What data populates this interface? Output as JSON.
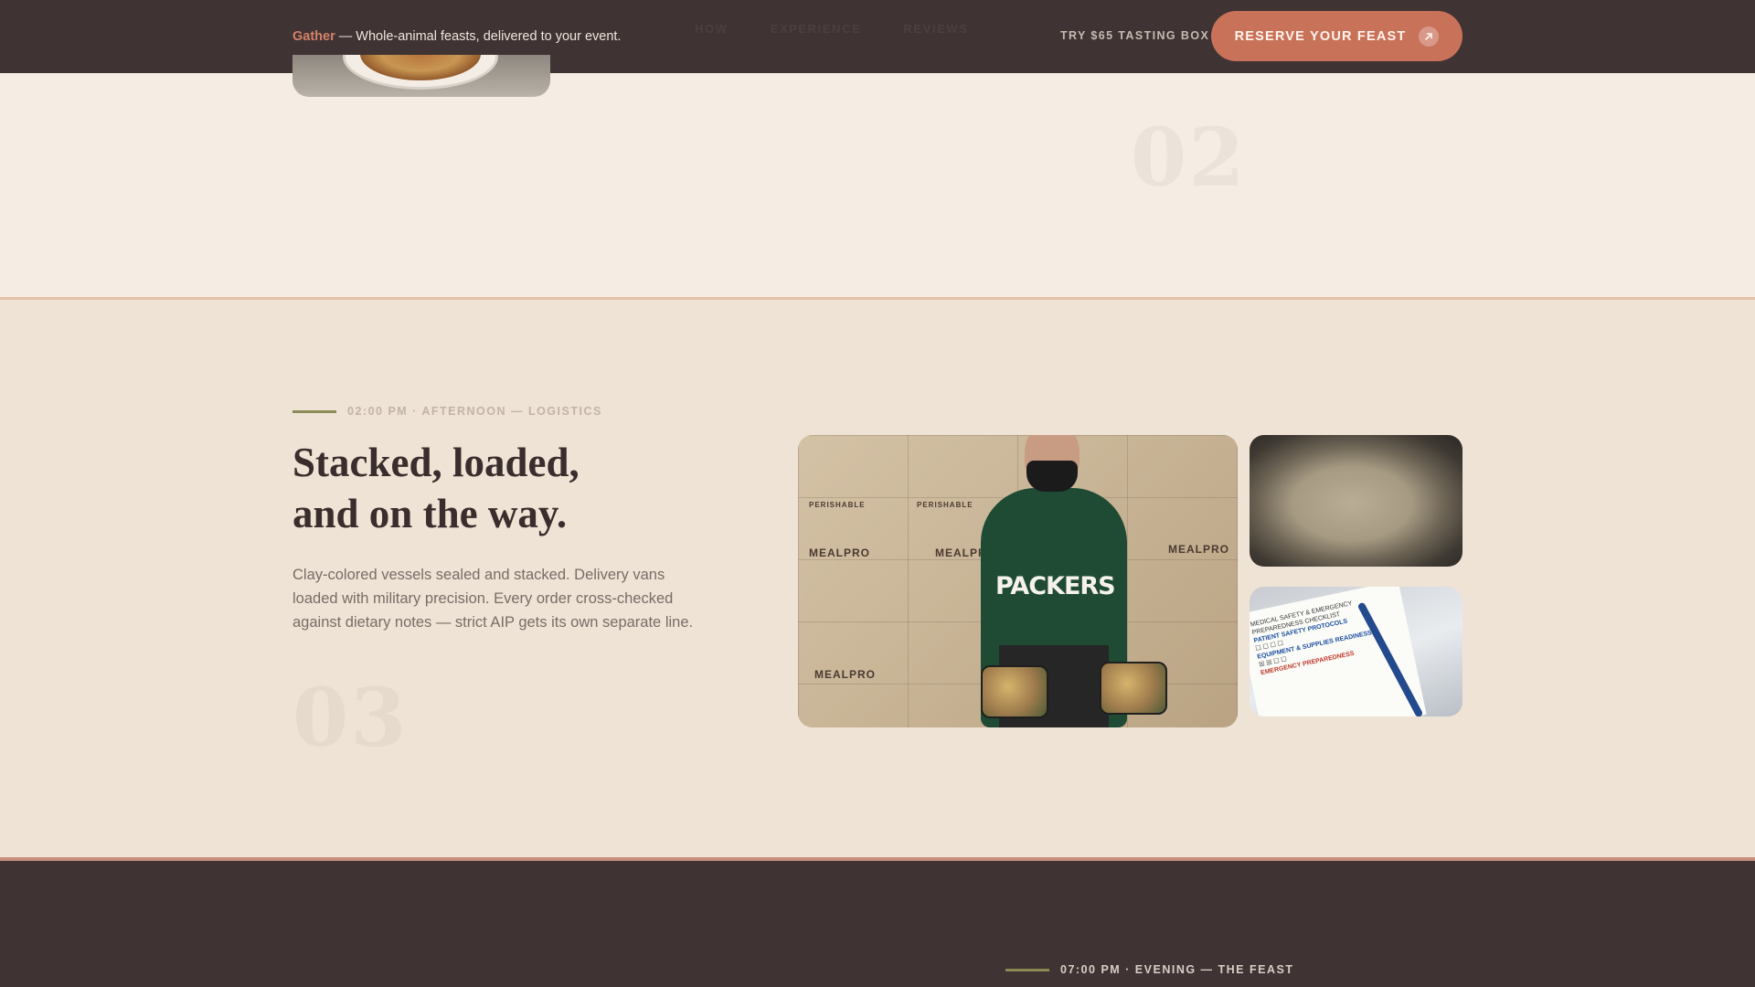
{
  "header": {
    "brand": "Gather",
    "tagline_rest": " — Whole-animal feasts, delivered to your event.",
    "nav_items": [
      "HOW",
      "EXPERIENCE",
      "REVIEWS"
    ],
    "tasting_label": "TRY $65 TASTING BOX",
    "reserve_label": "RESERVE YOUR FEAST",
    "reserve_icon": "arrow-up-right-icon"
  },
  "sections": {
    "prev": {
      "number": "02",
      "image_icon": "plated-dish-photo"
    },
    "logistics": {
      "eyebrow": "02:00 PM · AFTERNOON — LOGISTICS",
      "headline_line1": "Stacked, loaded,",
      "headline_line2": "and on the way.",
      "body": "Clay-colored vessels sealed and stacked. Delivery vans loaded with military precision. Every order cross-checked against dietary notes — strict AIP gets its own separate line.",
      "number": "03",
      "photos": {
        "main": {
          "box_brand": "MEALPRO",
          "box_tag": "PERISHABLE",
          "hoodie_text": "PACKERS"
        },
        "dough": "dough-in-bowl-photo",
        "checklist": {
          "title": "MEDICAL SAFETY & EMERGENCY PREPAREDNESS CHECKLIST",
          "heading_a": "PATIENT SAFETY PROTOCOLS",
          "heading_b": "EQUIPMENT & SUPPLIES READINESS",
          "heading_c": "EMERGENCY PREPAREDNESS"
        }
      }
    },
    "evening": {
      "eyebrow": "07:00 PM · EVENING — THE FEAST"
    }
  },
  "colors": {
    "nav_bg": "#3f3333",
    "accent": "#c9725a",
    "brand": "#d4826a",
    "olive_rule": "#8c8a56",
    "logistics_bg": "#efe3d5"
  }
}
